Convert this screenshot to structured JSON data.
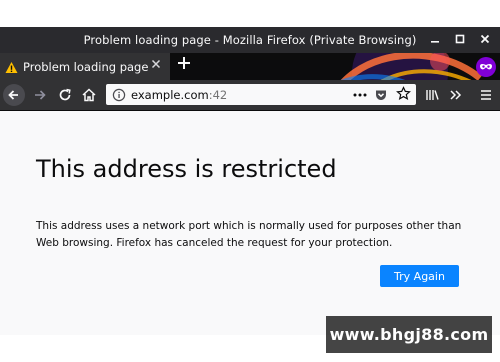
{
  "window": {
    "title": "Problem loading page - Mozilla Firefox (Private Browsing)"
  },
  "tab": {
    "label": "Problem loading page"
  },
  "urlbar": {
    "host": "example.com",
    "port": ":42"
  },
  "error": {
    "title": "This address is restricted",
    "description": "This address uses a network port which is normally used for purposes other than Web browsing. Firefox has canceled the request for your protection.",
    "button_label": "Try Again"
  },
  "watermark": {
    "text": "www.bhgj88.com"
  },
  "icons": {
    "warning": "warning-icon",
    "tab_close": "close-icon",
    "new_tab": "plus-icon",
    "private_browsing": "private-mask-icon",
    "back": "arrow-left-icon",
    "forward": "arrow-right-icon",
    "reload": "reload-icon",
    "home": "home-icon",
    "site_info": "info-icon",
    "page_actions": "ellipsis-icon",
    "pocket": "pocket-icon",
    "bookmark": "star-icon",
    "library": "library-icon",
    "overflow": "chevron-double-right-icon",
    "menu": "hamburger-menu-icon"
  },
  "colors": {
    "titlebar": "#2a2a2e",
    "toolbar": "#323234",
    "private_accent": "#8000d7",
    "button_primary": "#0a84ff",
    "warning": "#ffbf00"
  }
}
